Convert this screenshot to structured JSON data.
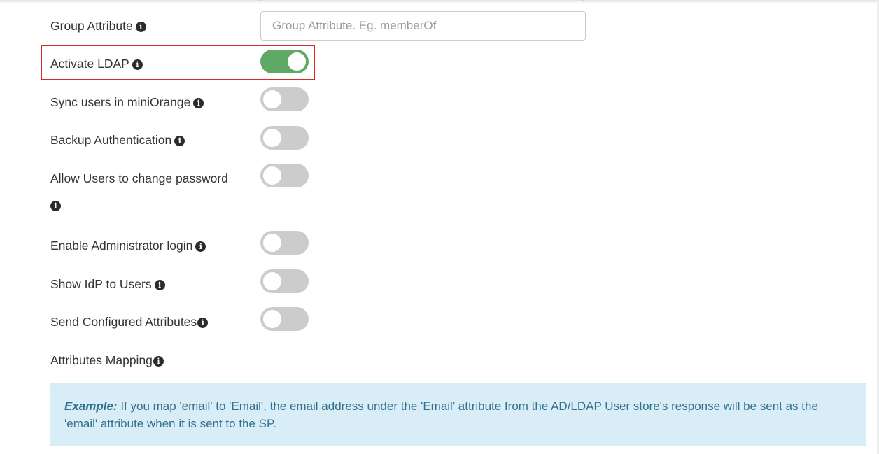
{
  "group_attribute": {
    "label": "Group Attribute",
    "placeholder": "Group Attribute. Eg. memberOf",
    "value": ""
  },
  "info_icon": {
    "glyph": "i",
    "name": "info-icon"
  },
  "toggles": [
    {
      "label": "Activate LDAP",
      "on": true,
      "highlighted": true
    },
    {
      "label": "Sync users in miniOrange",
      "on": false
    },
    {
      "label": "Backup Authentication",
      "on": false
    },
    {
      "label": "Allow Users to change password",
      "on": false
    },
    {
      "label": "Enable Administrator login",
      "on": false
    },
    {
      "label": "Show IdP to Users",
      "on": false
    },
    {
      "label": "Send Configured Attributes",
      "on": false
    }
  ],
  "attributes_mapping": {
    "label": "Attributes Mapping"
  },
  "example_box": {
    "title": "Example:",
    "text": "If you map 'email' to 'Email', the email address under the 'Email' attribute from the AD/LDAP User store's response will be sent as the 'email' attribute when it is sent to the SP."
  },
  "colors": {
    "toggle_on": "#5fa866",
    "toggle_off": "#cccccc",
    "highlight_border": "#d92626",
    "alert_bg": "#d9edf7",
    "alert_text": "#31708f"
  }
}
